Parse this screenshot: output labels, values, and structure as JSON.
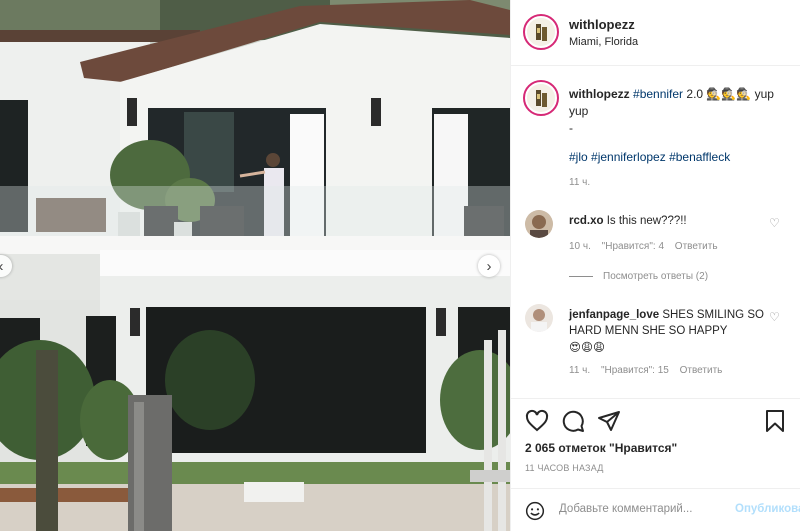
{
  "post": {
    "username": "withlopezz",
    "location": "Miami, Florida"
  },
  "caption": {
    "username": "withlopezz",
    "hashtag_main": "#bennifer",
    "text_main": " 2.0 🕵🕵🕵 yup yup",
    "dash": "-",
    "hashtags": "#jlo #jenniferlopez #benaffleck",
    "time": "11 ч."
  },
  "comments": [
    {
      "username": "rcd.xo",
      "text": "Is this new???!!",
      "time": "10 ч.",
      "likes": "\"Нравится\": 4",
      "reply": "Ответить",
      "view_replies": "Посмотреть ответы (2)"
    },
    {
      "username": "jenfanpage_love",
      "text": "SHES SMILING SO HARD MENN SHE SO HAPPY",
      "emoji": "😍😩😩",
      "time": "11 ч.",
      "likes": "\"Нравится\": 15",
      "reply": "Ответить"
    }
  ],
  "actions": {
    "icons": [
      "heart-icon",
      "comment-icon",
      "share-icon",
      "bookmark-icon"
    ],
    "likes_text": "2 065 отметок \"Нравится\"",
    "time_ago": "11 ЧАСОВ НАЗАД"
  },
  "add_comment": {
    "placeholder": "Добавьте комментарий...",
    "post_label": "Опубликовать"
  },
  "colors": {
    "story_ring": "#d62976",
    "hashtag": "#00376b",
    "muted": "#8e8e8e",
    "post_disabled": "#b2dffc"
  }
}
